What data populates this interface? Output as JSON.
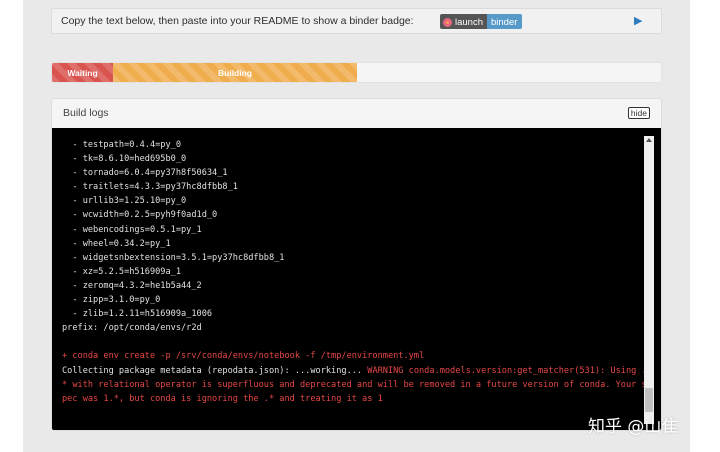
{
  "badge_bar": {
    "text": "Copy the text below, then paste into your README to show a binder badge:",
    "badge_left": "launch",
    "badge_right": "binder",
    "expand_icon": "triangle-right-icon"
  },
  "progress": {
    "waiting_label": "Waiting",
    "building_label": "Building",
    "colors": {
      "waiting": "#d9534f",
      "building": "#f0ad4e"
    }
  },
  "build_logs": {
    "title": "Build logs",
    "hide_label": "hide",
    "lines": [
      {
        "text": "  - testpath=0.4.4=py_0"
      },
      {
        "text": "  - tk=8.6.10=hed695b0_0"
      },
      {
        "text": "  - tornado=6.0.4=py37h8f50634_1"
      },
      {
        "text": "  - traitlets=4.3.3=py37hc8dfbb8_1"
      },
      {
        "text": "  - urllib3=1.25.10=py_0"
      },
      {
        "text": "  - wcwidth=0.2.5=pyh9f0ad1d_0"
      },
      {
        "text": "  - webencodings=0.5.1=py_1"
      },
      {
        "text": "  - wheel=0.34.2=py_1"
      },
      {
        "text": "  - widgetsnbextension=3.5.1=py37hc8dfbb8_1"
      },
      {
        "text": "  - xz=5.2.5=h516909a_1"
      },
      {
        "text": "  - zeromq=4.3.2=he1b5a44_2"
      },
      {
        "text": "  - zipp=3.1.0=py_0"
      },
      {
        "text": "  - zlib=1.2.11=h516909a_1006"
      },
      {
        "text": "prefix: /opt/conda/envs/r2d"
      },
      {
        "text": ""
      },
      {
        "text": "+ conda env create -p /srv/conda/envs/notebook -f /tmp/environment.yml",
        "style": "red"
      },
      {
        "text": "Collecting package metadata (repodata.json): ...working... ",
        "warn": "WARNING conda.models.version:get_matcher(531): Using ."
      },
      {
        "text": "* with relational operator is superfluous and deprecated and will be removed in a future version of conda. Your s",
        "style": "red"
      },
      {
        "text": "pec was 1.*, but conda is ignoring the .* and treating it as 1",
        "style": "red"
      }
    ]
  },
  "watermark": "知乎 @山隹"
}
